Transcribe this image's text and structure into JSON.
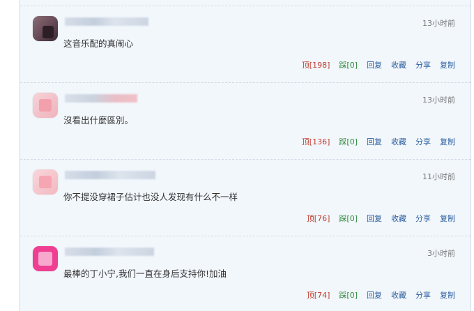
{
  "comments": [
    {
      "time": "13小时前",
      "text": "这音乐配的真闹心",
      "actions": {
        "ding": "顶[198]",
        "cai": "踩[0]",
        "reply": "回复",
        "favorite": "收藏",
        "share": "分享",
        "copy": "复制"
      }
    },
    {
      "time": "13小时前",
      "text": "沒看出什麼區別。",
      "actions": {
        "ding": "顶[136]",
        "cai": "踩[0]",
        "reply": "回复",
        "favorite": "收藏",
        "share": "分享",
        "copy": "复制"
      }
    },
    {
      "time": "11小时前",
      "text": "你不提没穿裙子估计也没人发现有什么不一样",
      "actions": {
        "ding": "顶[76]",
        "cai": "踩[0]",
        "reply": "回复",
        "favorite": "收藏",
        "share": "分享",
        "copy": "复制"
      }
    },
    {
      "time": "3小时前",
      "text": "最棒的丁小宁,我们一直在身后支持你!加油",
      "actions": {
        "ding": "顶[74]",
        "cai": "踩[0]",
        "reply": "回复",
        "favorite": "收藏",
        "share": "分享",
        "copy": "复制"
      }
    }
  ]
}
